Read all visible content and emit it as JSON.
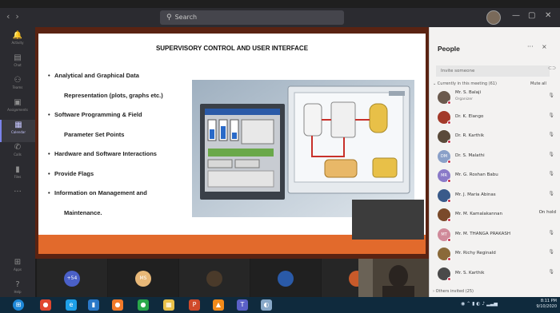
{
  "titlebar": {
    "search_placeholder": "Search"
  },
  "rail": [
    {
      "icon": "bell-icon",
      "label": "Activity"
    },
    {
      "icon": "chat-icon",
      "label": "Chat"
    },
    {
      "icon": "teams-icon",
      "label": "Teams"
    },
    {
      "icon": "assignments-icon",
      "label": "Assignments"
    },
    {
      "icon": "calendar-icon",
      "label": "Calendar"
    },
    {
      "icon": "calls-icon",
      "label": "Calls"
    },
    {
      "icon": "files-icon",
      "label": "Files"
    },
    {
      "icon": "more-icon",
      "label": "..."
    },
    {
      "icon": "apps-icon",
      "label": "Apps"
    },
    {
      "icon": "help-icon",
      "label": "Help"
    }
  ],
  "slide": {
    "title": "SUPERVISORY CONTROL AND USER INTERFACE",
    "bullets": [
      {
        "bullet": "•",
        "text": "Analytical and Graphical Data"
      },
      {
        "bullet": "",
        "text": "Representation (plots, graphs etc.)"
      },
      {
        "bullet": "•",
        "text": "Software Programming & Field"
      },
      {
        "bullet": "",
        "text": "Parameter Set Points"
      },
      {
        "bullet": "•",
        "text": "Hardware and Software Interactions"
      },
      {
        "bullet": "•",
        "text": "Provide Flags"
      },
      {
        "bullet": "•",
        "text": "Information on Management and"
      },
      {
        "bullet": "",
        "text": "Maintenance."
      }
    ]
  },
  "people": {
    "title": "People",
    "more": "···",
    "close": "×",
    "invite_placeholder": "Invite someone",
    "section": "Currently in this meeting (61)",
    "mute_all": "Mute all",
    "others": "Others invited (25)",
    "list": [
      {
        "name": "Mr. S. Balaji",
        "sub": "Organizer",
        "initials": "",
        "color": "#6b5a4e",
        "status": "mic"
      },
      {
        "name": "Dr. K. Elango",
        "sub": "",
        "initials": "",
        "color": "#a33a2a",
        "status": "mic"
      },
      {
        "name": "Dr. R. Karthik",
        "sub": "",
        "initials": "",
        "color": "#5a4a3a",
        "status": "mic"
      },
      {
        "name": "Dr. S. Malathi",
        "sub": "",
        "initials": "DM",
        "color": "#8aa0c8",
        "status": "mic"
      },
      {
        "name": "Mr. G. Roshan Babu",
        "sub": "",
        "initials": "MR",
        "color": "#8a7ac8",
        "status": "mic"
      },
      {
        "name": "Mr. J. Maria Abinas",
        "sub": "",
        "initials": "",
        "color": "#3a5a8a",
        "status": "mic"
      },
      {
        "name": "Mr. M. Kamalakannan",
        "sub": "",
        "initials": "",
        "color": "#7a4a2a",
        "status": "On hold"
      },
      {
        "name": "Mr. M. THANGA PRAKASH",
        "sub": "",
        "initials": "MT",
        "color": "#d08a9a",
        "status": "mic"
      },
      {
        "name": "Mr. Richy Reginald",
        "sub": "",
        "initials": "",
        "color": "#8a6a3a",
        "status": "mic"
      },
      {
        "name": "Mr. S. Karthik",
        "sub": "",
        "initials": "",
        "color": "#4a4a4a",
        "status": "mic"
      }
    ]
  },
  "strip": [
    {
      "label": "+54",
      "color": "#4a60c8"
    },
    {
      "label": "MS",
      "color": "#e8b878"
    },
    {
      "label": "",
      "color": "#4a3a2a"
    },
    {
      "label": "",
      "color": "#2a5aa8"
    },
    {
      "label": "",
      "color": "#c85a2a"
    },
    {
      "label": "",
      "color": "#2a7ab8"
    }
  ],
  "taskbar": {
    "clock_time": "8:11 PM",
    "clock_date": "9/10/2020",
    "apps": [
      {
        "icon": "start-icon",
        "glyph": "⊞",
        "color": "#1e88d8"
      },
      {
        "icon": "chrome-icon",
        "glyph": "●",
        "color": "#e0472f"
      },
      {
        "icon": "ie-icon",
        "glyph": "e",
        "color": "#1ea0e8"
      },
      {
        "icon": "explorer-icon",
        "glyph": "▮",
        "color": "#2a78c8"
      },
      {
        "icon": "firefox-icon",
        "glyph": "●",
        "color": "#f07a2a"
      },
      {
        "icon": "whatsapp-icon",
        "glyph": "●",
        "color": "#2aa84a"
      },
      {
        "icon": "files-icon",
        "glyph": "▦",
        "color": "#e8c048"
      },
      {
        "icon": "powerpoint-icon",
        "glyph": "P",
        "color": "#d04a2a"
      },
      {
        "icon": "vlc-icon",
        "glyph": "▲",
        "color": "#f08a1a"
      },
      {
        "icon": "teams-icon",
        "glyph": "T",
        "color": "#5a60c8"
      },
      {
        "icon": "paint-icon",
        "glyph": "◐",
        "color": "#88a8c8"
      }
    ]
  }
}
